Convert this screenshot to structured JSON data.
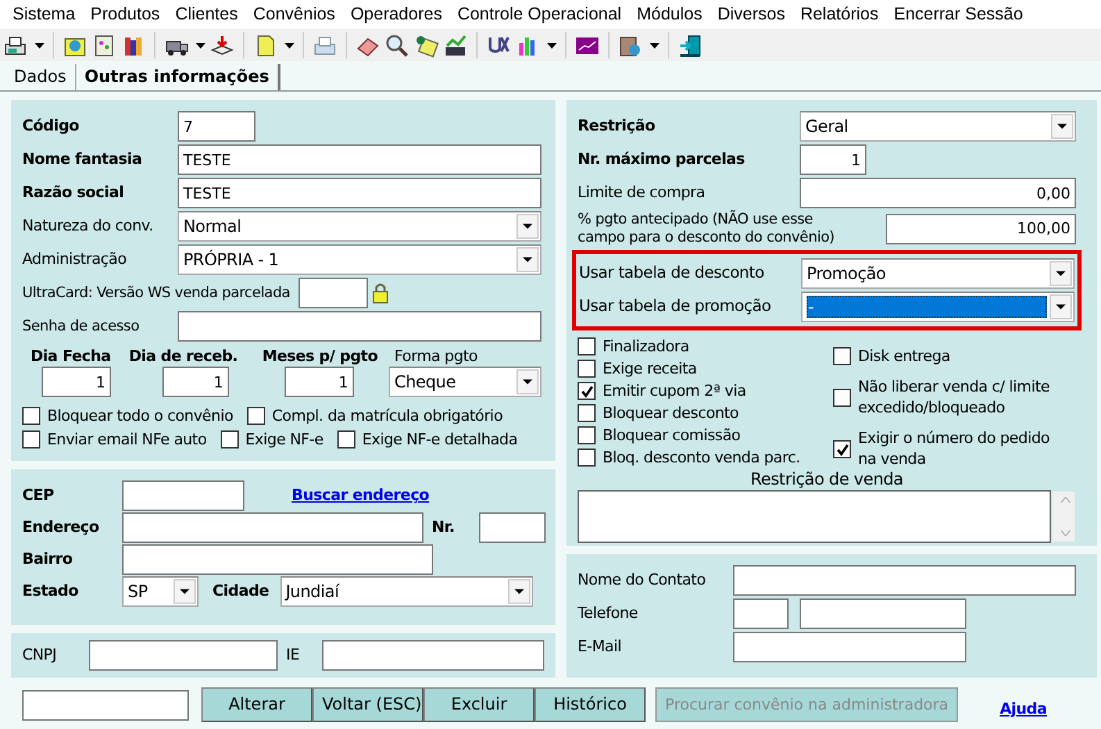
{
  "menu": [
    "Sistema",
    "Produtos",
    "Clientes",
    "Convênios",
    "Operadores",
    "Controle Operacional",
    "Módulos",
    "Diversos",
    "Relatórios",
    "Encerrar Sessão"
  ],
  "tabs": [
    {
      "label": "Dados",
      "selected": false
    },
    {
      "label": "Outras informações",
      "selected": true
    }
  ],
  "identity": [
    {
      "label": "Código",
      "bold": true,
      "kind": "input",
      "value": "7"
    },
    {
      "label": "Nome fantasia",
      "bold": true,
      "kind": "input",
      "value": "TESTE"
    },
    {
      "label": "Razão social",
      "bold": true,
      "kind": "input",
      "value": "TESTE"
    },
    {
      "label": "Natureza do conv.",
      "bold": false,
      "kind": "select",
      "value": "Normal"
    },
    {
      "label": "Administração",
      "bold": false,
      "kind": "select",
      "value": "PRÓPRIA - 1"
    },
    {
      "label": "UltraCard: Versão WS venda parcelada",
      "bold": false,
      "kind": "input",
      "locked": true
    },
    {
      "label": "Senha de acesso",
      "bold": false,
      "kind": "input"
    }
  ],
  "schedule": [
    {
      "label": "Dia Fecha",
      "bold": true,
      "kind": "input",
      "value": "1"
    },
    {
      "label": "Dia de receb.",
      "bold": true,
      "kind": "input",
      "value": "1"
    },
    {
      "label": "Meses p/ pgto",
      "bold": true,
      "kind": "input",
      "value": "1"
    },
    {
      "label": "Forma pgto",
      "bold": false,
      "kind": "select",
      "value": "Cheque"
    }
  ],
  "options": [
    [
      {
        "label": "Bloquear todo o convênio",
        "checked": false
      },
      {
        "label": "Compl. da matrícula obrigatório",
        "checked": false
      }
    ],
    [
      {
        "label": "Enviar email NFe auto",
        "checked": false
      },
      {
        "label": "Exige NF-e",
        "checked": false
      },
      {
        "label": "Exige NF-e detalhada",
        "checked": false
      }
    ]
  ],
  "address": [
    [
      {
        "label": "CEP",
        "bold": true,
        "kind": "input"
      },
      {
        "label": "Buscar endereço",
        "kind": "link"
      }
    ],
    [
      {
        "label": "Endereço",
        "bold": true,
        "kind": "input"
      },
      {
        "label": "Nr.",
        "bold": true,
        "kind": "input"
      }
    ],
    [
      {
        "label": "Bairro",
        "bold": true,
        "kind": "input"
      }
    ],
    [
      {
        "label": "Estado",
        "bold": true,
        "kind": "select",
        "value": "SP"
      },
      {
        "label": "Cidade",
        "bold": true,
        "kind": "select",
        "value": "Jundiaí"
      }
    ]
  ],
  "documents": [
    {
      "label": "CNPJ",
      "bold": false,
      "kind": "input"
    },
    {
      "label": "IE",
      "bold": false,
      "kind": "input"
    }
  ],
  "conditions": [
    {
      "label": "Restrição",
      "bold": true,
      "kind": "select",
      "value": "Geral"
    },
    {
      "label": "Nr. máximo parcelas",
      "bold": true,
      "kind": "input",
      "value": "1"
    },
    {
      "label": "Limite de compra",
      "bold": false,
      "kind": "input",
      "value": "0,00"
    },
    {
      "label": "% pgto antecipado (NÃO use esse campo para o desconto do convênio)",
      "bold": false,
      "kind": "input",
      "value": "100,00"
    }
  ],
  "discount_tables": {
    "highlighted": true,
    "fields": [
      {
        "label": "Usar tabela de desconto",
        "kind": "select",
        "value": "Promoção",
        "focused": false
      },
      {
        "label": "Usar tabela de promoção",
        "kind": "select",
        "value": "-",
        "focused": true
      }
    ]
  },
  "flags_left": [
    {
      "label": "Finalizadora",
      "checked": false
    },
    {
      "label": "Exige receita",
      "checked": false
    },
    {
      "label": "Emitir cupom 2ª via",
      "checked": true
    },
    {
      "label": "Bloquear desconto",
      "checked": false
    },
    {
      "label": "Bloquear comissão",
      "checked": false
    },
    {
      "label": "Bloq. desconto venda parc.",
      "checked": false
    }
  ],
  "flags_right": [
    {
      "label": "Disk entrega",
      "checked": false
    },
    {
      "label": "Não liberar venda c/ limite excedido/bloqueado",
      "checked": false
    },
    {
      "label": "Exigir o número do pedido na venda",
      "checked": true
    }
  ],
  "sale_restriction": {
    "label": "Restrição de venda"
  },
  "contact": [
    {
      "label": "Nome do Contato",
      "kind": "input"
    },
    {
      "label": "Telefone",
      "kind": "phone"
    },
    {
      "label": "E-Mail",
      "kind": "input"
    }
  ],
  "buttons": [
    {
      "label": "Alterar",
      "disabled": false
    },
    {
      "label": "Voltar (ESC)",
      "disabled": false
    },
    {
      "label": "Excluir",
      "disabled": false
    },
    {
      "label": "Histórico",
      "disabled": false
    },
    {
      "label": "Procurar convênio na administradora",
      "disabled": true
    }
  ],
  "help_link": "Ajuda"
}
